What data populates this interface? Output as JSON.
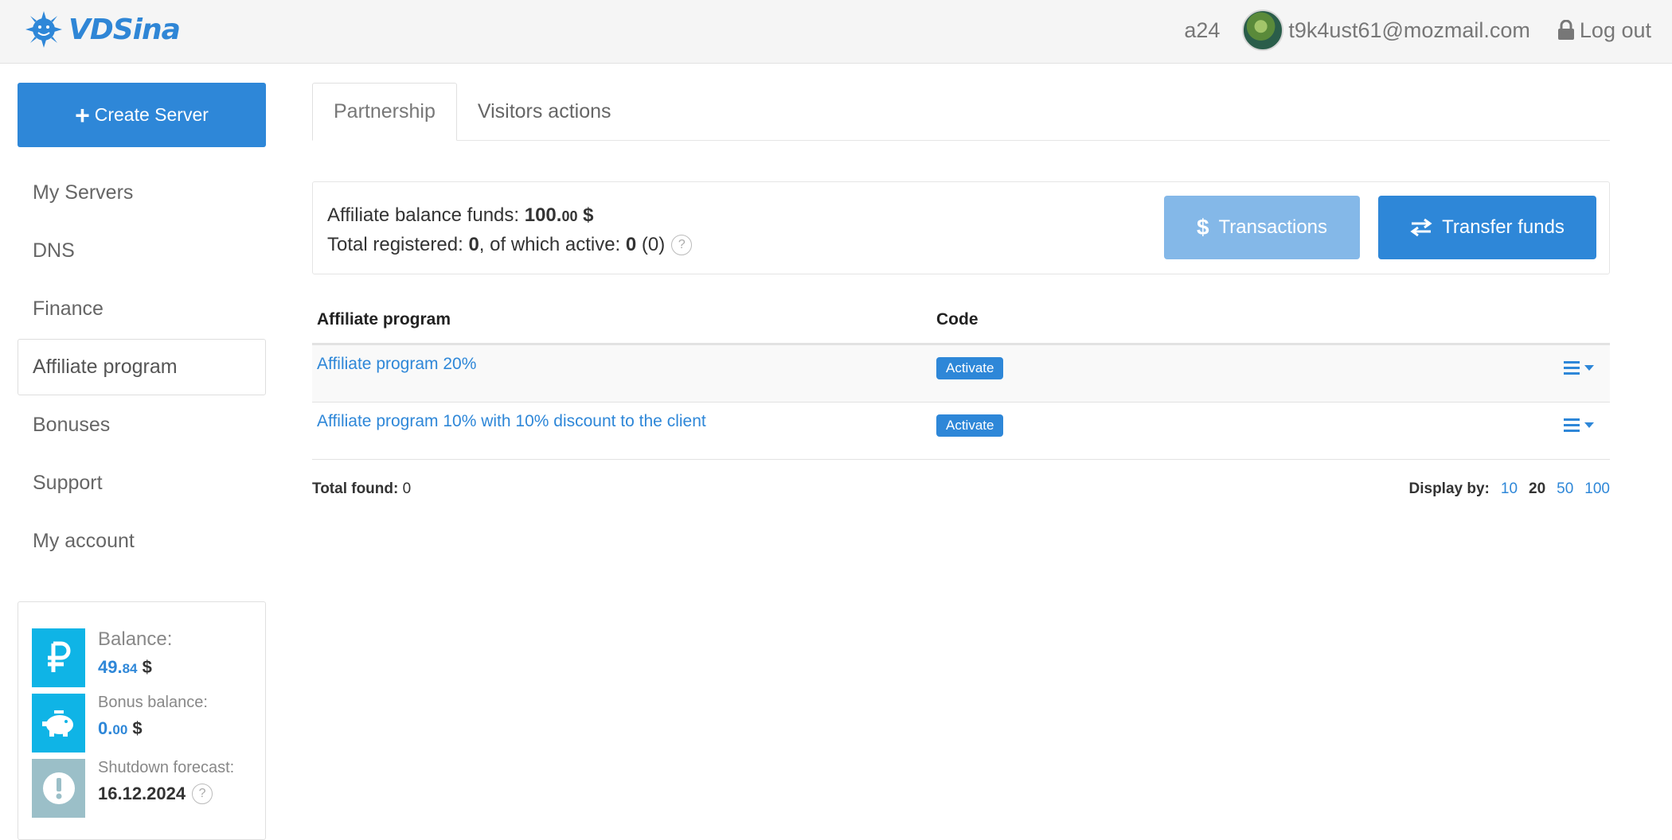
{
  "header": {
    "brand": "VDSina",
    "user_id": "a24",
    "email": "t9k4ust61@mozmail.com",
    "logout_label": "Log out",
    "icons": {
      "logo": "sun-logo-icon",
      "avatar": "avatar",
      "lock": "lock-icon"
    }
  },
  "sidebar": {
    "create_label": "Create Server",
    "items": [
      {
        "label": "My Servers"
      },
      {
        "label": "DNS"
      },
      {
        "label": "Finance"
      },
      {
        "label": "Affiliate program",
        "active": true
      },
      {
        "label": "Bonuses"
      },
      {
        "label": "Support"
      },
      {
        "label": "My account"
      }
    ],
    "balance": {
      "label": "Balance:",
      "value_int": "49.",
      "value_dec": "84",
      "currency": "$"
    },
    "bonus": {
      "label": "Bonus balance:",
      "value_int": "0.",
      "value_dec": "00",
      "currency": "$"
    },
    "shutdown": {
      "label": "Shutdown forecast:",
      "date": "16.12.2024"
    }
  },
  "tabs": [
    {
      "label": "Partnership",
      "active": true
    },
    {
      "label": "Visitors actions",
      "active": false
    }
  ],
  "summary": {
    "balance_label": "Affiliate balance funds:",
    "balance_int": "100.",
    "balance_dec": "00",
    "balance_cur": "$",
    "registered_label": "Total registered:",
    "registered_value": "0",
    "active_label": ", of which active:",
    "active_value": "0",
    "active_paren": "(0)",
    "help": "?",
    "transactions_label": "Transactions",
    "transfer_label": "Transfer funds"
  },
  "table": {
    "headers": {
      "name": "Affiliate program",
      "code": "Code"
    },
    "rows": [
      {
        "name": "Affiliate program 20%",
        "code_button": "Activate"
      },
      {
        "name": "Affiliate program 10% with 10% discount to the client",
        "code_button": "Activate"
      }
    ]
  },
  "footer": {
    "total_label": "Total found:",
    "total_value": "0",
    "display_label": "Display by:",
    "options": [
      "10",
      "20",
      "50",
      "100"
    ],
    "current": "20"
  },
  "colors": {
    "accent": "#2e87d8",
    "accent_light": "#84b8e8",
    "balance_icon": "#0fb4e6",
    "shutdown_icon": "#9bbfc8"
  }
}
